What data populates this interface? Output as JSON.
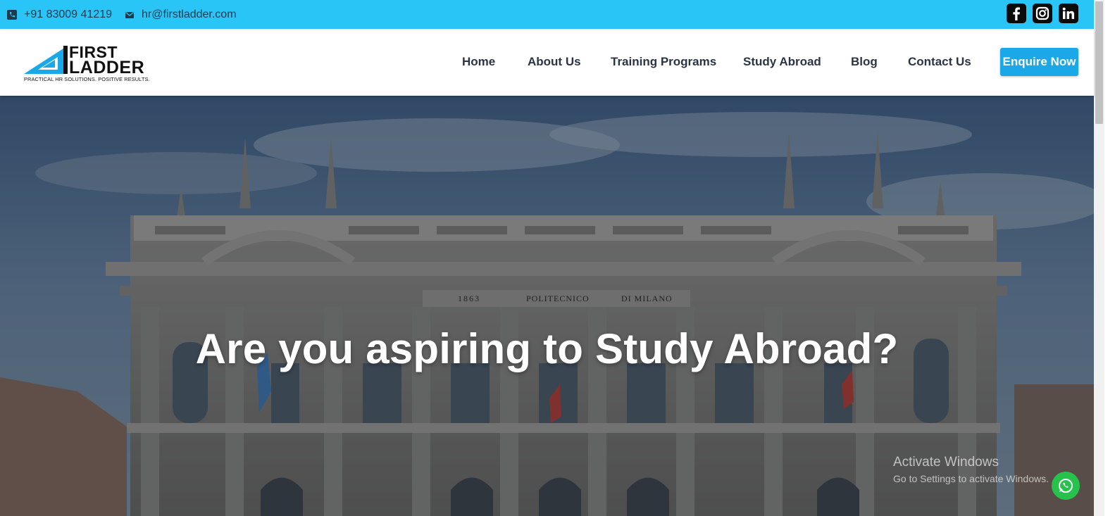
{
  "topbar": {
    "phone": "+91 83009 41219",
    "email": "hr@firstladder.com",
    "social": [
      "facebook-icon",
      "instagram-icon",
      "linkedin-icon"
    ]
  },
  "brand": {
    "line1": "FIRST",
    "line2": "LADDER",
    "tagline": "PRACTICAL HR SOLUTIONS. POSITIVE RESULTS.",
    "accent": "#1aa8e8"
  },
  "nav": {
    "items": [
      "Home",
      "About Us",
      "Training Programs",
      "Study Abroad",
      "Blog",
      "Contact Us"
    ],
    "cta": "Enquire Now"
  },
  "hero": {
    "title": "Are you aspiring to Study Abroad?",
    "building_inscription": [
      "1863",
      "POLITECNICO",
      "DI MILANO"
    ]
  },
  "watermark": {
    "line1": "Activate Windows",
    "line2": "Go to Settings to activate Windows."
  },
  "colors": {
    "topbar": "#29c5f6",
    "cta": "#1aa8e8",
    "nav_text": "#2b3445",
    "whatsapp": "#27c24c"
  }
}
